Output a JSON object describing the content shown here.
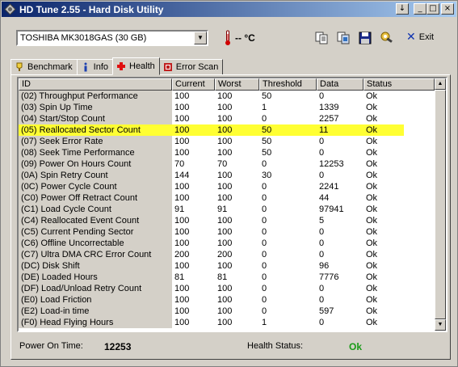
{
  "window": {
    "title": "HD Tune 2.55 - Hard Disk Utility",
    "buttons": {
      "dropdown": "↓",
      "minimize": "_",
      "maximize": "□",
      "close": "×"
    }
  },
  "toolbar": {
    "drive": "TOSHIBA MK3018GAS (30 GB)",
    "temperature": "-- °C",
    "icons": [
      "copy-info-icon",
      "copy-screen-icon",
      "save-icon",
      "options-icon"
    ],
    "exit_label": "Exit"
  },
  "tabs": [
    {
      "label": "Benchmark",
      "icon": "benchmark-icon"
    },
    {
      "label": "Info",
      "icon": "info-icon"
    },
    {
      "label": "Health",
      "icon": "health-icon",
      "active": true
    },
    {
      "label": "Error Scan",
      "icon": "error-scan-icon"
    }
  ],
  "table": {
    "columns": [
      "ID",
      "Current",
      "Worst",
      "Threshold",
      "Data",
      "Status"
    ],
    "rows": [
      [
        "(02) Throughput Performance",
        "100",
        "100",
        "50",
        "0",
        "Ok"
      ],
      [
        "(03) Spin Up Time",
        "100",
        "100",
        "1",
        "1339",
        "Ok"
      ],
      [
        "(04) Start/Stop Count",
        "100",
        "100",
        "0",
        "2257",
        "Ok"
      ],
      [
        "(05) Reallocated Sector Count",
        "100",
        "100",
        "50",
        "11",
        "Ok"
      ],
      [
        "(07) Seek Error Rate",
        "100",
        "100",
        "50",
        "0",
        "Ok"
      ],
      [
        "(08) Seek Time Performance",
        "100",
        "100",
        "50",
        "0",
        "Ok"
      ],
      [
        "(09) Power On Hours Count",
        "70",
        "70",
        "0",
        "12253",
        "Ok"
      ],
      [
        "(0A) Spin Retry Count",
        "144",
        "100",
        "30",
        "0",
        "Ok"
      ],
      [
        "(0C) Power Cycle Count",
        "100",
        "100",
        "0",
        "2241",
        "Ok"
      ],
      [
        "(C0) Power Off Retract Count",
        "100",
        "100",
        "0",
        "44",
        "Ok"
      ],
      [
        "(C1) Load Cycle Count",
        "91",
        "91",
        "0",
        "97941",
        "Ok"
      ],
      [
        "(C4) Reallocated Event Count",
        "100",
        "100",
        "0",
        "5",
        "Ok"
      ],
      [
        "(C5) Current Pending Sector",
        "100",
        "100",
        "0",
        "0",
        "Ok"
      ],
      [
        "(C6) Offline Uncorrectable",
        "100",
        "100",
        "0",
        "0",
        "Ok"
      ],
      [
        "(C7) Ultra DMA CRC Error Count",
        "200",
        "200",
        "0",
        "0",
        "Ok"
      ],
      [
        "(DC) Disk Shift",
        "100",
        "100",
        "0",
        "96",
        "Ok"
      ],
      [
        "(DE) Loaded Hours",
        "81",
        "81",
        "0",
        "7776",
        "Ok"
      ],
      [
        "(DF) Load/Unload Retry Count",
        "100",
        "100",
        "0",
        "0",
        "Ok"
      ],
      [
        "(E0) Load Friction",
        "100",
        "100",
        "0",
        "0",
        "Ok"
      ],
      [
        "(E2) Load-in time",
        "100",
        "100",
        "0",
        "597",
        "Ok"
      ],
      [
        "(F0) Head Flying Hours",
        "100",
        "100",
        "1",
        "0",
        "Ok"
      ]
    ],
    "highlighted_row": 3,
    "highlight_color": "#ffff33"
  },
  "status": {
    "power_on_label": "Power On Time:",
    "power_on_value": "12253",
    "health_label": "Health Status:",
    "health_value": "Ok",
    "health_color": "#1a9b18"
  }
}
